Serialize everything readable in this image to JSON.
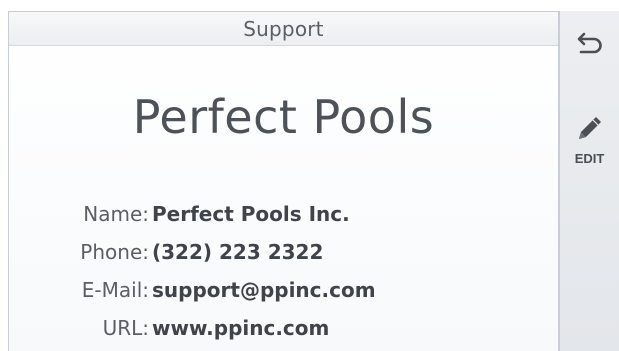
{
  "header": {
    "title": "Support"
  },
  "company": {
    "name": "Perfect Pools"
  },
  "details": [
    {
      "label": "Name:",
      "value": "Perfect Pools Inc."
    },
    {
      "label": "Phone:",
      "value": "(322) 223 2322"
    },
    {
      "label": "E-Mail:",
      "value": "support@ppinc.com"
    },
    {
      "label": "URL:",
      "value": "www.ppinc.com"
    }
  ],
  "sidebar": {
    "back_icon": "back-arrow-icon",
    "edit_icon": "pencil-icon",
    "edit_label": "EDIT"
  },
  "colors": {
    "text_dark": "#4d5158",
    "value_text": "#3f434a",
    "sidebar_bg": "#e7e9ec"
  }
}
